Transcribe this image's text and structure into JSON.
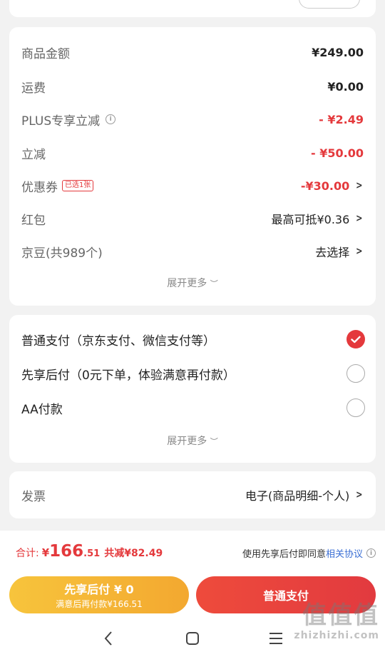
{
  "summary": {
    "rows": [
      {
        "label": "商品金额",
        "value": "¥249.00"
      },
      {
        "label": "运费",
        "value": "¥0.00"
      },
      {
        "label": "PLUS专享立减",
        "value": "- ¥2.49"
      },
      {
        "label": "立减",
        "value": "- ¥50.00"
      },
      {
        "label": "优惠券",
        "tag": "已选1张",
        "value": "-¥30.00"
      },
      {
        "label": "红包",
        "value": "最高可抵¥0.36"
      },
      {
        "label": "京豆(共989个)",
        "value": "去选择"
      }
    ],
    "expand_label": "展开更多"
  },
  "payment": {
    "options": [
      {
        "label": "普通支付（京东支付、微信支付等）",
        "selected": true
      },
      {
        "label": "先享后付（0元下单，体验满意再付款）",
        "selected": false
      },
      {
        "label": "AA付款",
        "selected": false
      }
    ],
    "expand_label": "展开更多"
  },
  "invoice": {
    "label": "发票",
    "value": "电子(商品明细-个人)"
  },
  "footer": {
    "total_label": "合计:",
    "total_currency": "¥",
    "total_int": "166",
    "total_dec": ".51",
    "saved": "共减¥82.49",
    "agree_text": "使用先享后付即同意",
    "agree_link": "相关协议",
    "btn_later_title": "先享后付 ¥ 0",
    "btn_later_sub": "满意后再付款¥166.51",
    "btn_pay": "普通支付"
  },
  "watermark": {
    "logo": "值值值",
    "url": "zhizhizhi.com"
  },
  "colors": {
    "accent_red": "#e4393c",
    "later_button": "#f5b533",
    "pay_button": "#e4393c"
  },
  "icons": [
    "info-icon",
    "chevron-right-icon",
    "check-icon",
    "back-icon",
    "home-icon",
    "menu-icon"
  ]
}
